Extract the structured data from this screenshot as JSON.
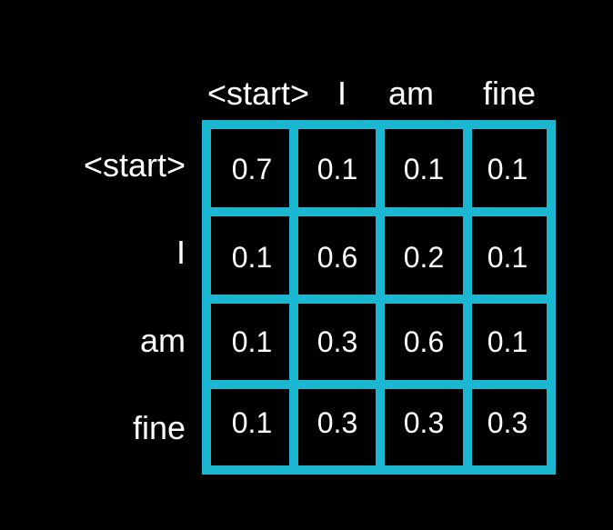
{
  "matrix": {
    "columns": [
      "<start>",
      "I",
      "am",
      "fine"
    ],
    "rows": [
      "<start>",
      "I",
      "am",
      "fine"
    ],
    "values": [
      [
        "0.7",
        "0.1",
        "0.1",
        "0.1"
      ],
      [
        "0.1",
        "0.6",
        "0.2",
        "0.1"
      ],
      [
        "0.1",
        "0.3",
        "0.6",
        "0.1"
      ],
      [
        "0.1",
        "0.3",
        "0.3",
        "0.3"
      ]
    ]
  },
  "colors": {
    "background": "#000000",
    "grid": "#1bb7d0",
    "text": "#ffffff"
  }
}
